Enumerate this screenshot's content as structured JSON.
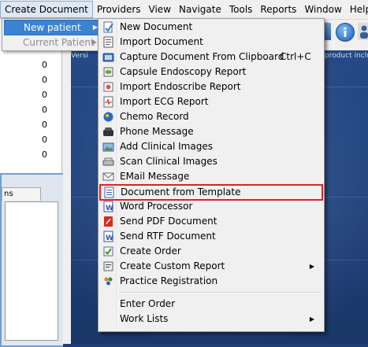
{
  "menubar": {
    "items": [
      "Create Document",
      "Providers",
      "View",
      "Navigate",
      "Tools",
      "Reports",
      "Window",
      "Help"
    ]
  },
  "submenu": {
    "items": [
      {
        "label": "New patient",
        "state": "active"
      },
      {
        "label": "Current Patient",
        "state": "disabled"
      }
    ]
  },
  "left_panel": {
    "counts": [
      "0",
      "0",
      "0",
      "0",
      "0",
      "0",
      "0"
    ],
    "tab_label": "ns"
  },
  "background": {
    "version_prefix": "Versi",
    "version_suffix": "product inclu"
  },
  "document_menu": {
    "items": [
      {
        "label": "New Document",
        "icon": "new-document-icon"
      },
      {
        "label": "Import Document",
        "icon": "import-document-icon"
      },
      {
        "label": "Capture Document From Clipboard",
        "shortcut": "Ctrl+C",
        "icon": "capture-icon"
      },
      {
        "label": "Capsule Endoscopy Report",
        "icon": "capsule-endoscopy-icon"
      },
      {
        "label": "Import Endoscribe Report",
        "icon": "endoscribe-icon"
      },
      {
        "label": "Import ECG Report",
        "icon": "ecg-icon"
      },
      {
        "label": "Chemo Record",
        "icon": "chemo-icon"
      },
      {
        "label": "Phone Message",
        "icon": "phone-icon"
      },
      {
        "label": "Add Clinical Images",
        "icon": "clinical-images-icon"
      },
      {
        "label": "Scan Clinical Images",
        "icon": "scanner-icon"
      },
      {
        "label": "EMail Message",
        "icon": "email-icon"
      },
      {
        "label": "Document from Template",
        "icon": "template-icon",
        "highlighted": true
      },
      {
        "label": "Word Processor",
        "icon": "word-icon"
      },
      {
        "label": "Send PDF Document",
        "icon": "pdf-icon"
      },
      {
        "label": "Send RTF Document",
        "icon": "rtf-icon"
      },
      {
        "label": "Create Order",
        "icon": "order-icon"
      },
      {
        "label": "Create Custom Report",
        "icon": "custom-report-icon",
        "has_submenu": true
      },
      {
        "label": "Practice Registration",
        "icon": "registration-icon"
      },
      {
        "label": "Enter Order"
      },
      {
        "label": "Work Lists",
        "has_submenu": true
      }
    ]
  },
  "colors": {
    "highlight_border": "#e02020",
    "menu_active": "#3b82cf",
    "background_blue": "#20427c"
  }
}
